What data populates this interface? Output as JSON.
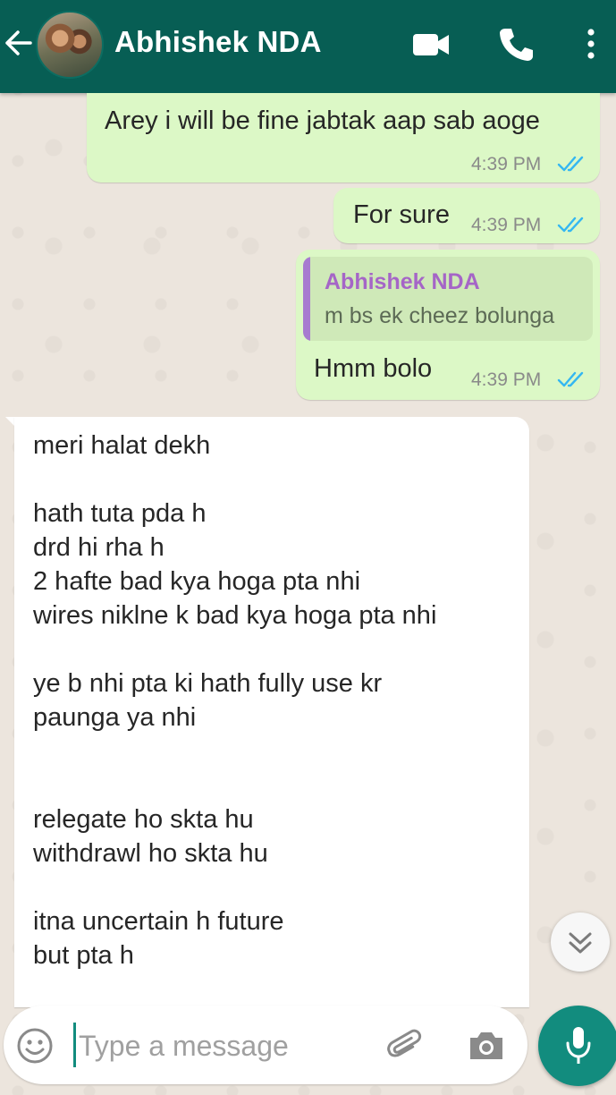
{
  "header": {
    "contact_name": "Abhishek NDA",
    "back_icon": "arrow-left-icon",
    "video_icon": "videocam-icon",
    "call_icon": "phone-icon",
    "menu_icon": "more-vert-icon",
    "bg_color": "#075e54"
  },
  "messages": {
    "m1": {
      "text": "Arey i will be fine jabtak aap sab aoge",
      "time": "4:39 PM",
      "status": "read"
    },
    "m2": {
      "text": "For sure",
      "time": "4:39 PM",
      "status": "read"
    },
    "m3": {
      "quote_author": "Abhishek NDA",
      "quote_text": "m bs ek cheez bolunga",
      "text": "Hmm bolo",
      "time": "4:39 PM",
      "status": "read"
    },
    "m4": {
      "lines": [
        "meri halat dekh",
        "hath tuta pda h",
        "drd hi rha h",
        "2 hafte bad kya hoga pta nhi",
        "wires niklne k bad kya hoga pta nhi",
        "ye b nhi pta ki hath fully use kr",
        "paunga ya nhi",
        "relegate ho skta hu",
        "withdrawl ho skta hu",
        "itna uncertain h future",
        "but pta h"
      ]
    }
  },
  "composer": {
    "placeholder": "Type a message",
    "emoji_icon": "emoji-icon",
    "attach_icon": "paperclip-icon",
    "camera_icon": "camera-icon",
    "mic_icon": "mic-icon"
  },
  "colors": {
    "outgoing_bubble": "#dcf8c6",
    "incoming_bubble": "#ffffff",
    "read_tick": "#34b7f1",
    "accent": "#128c7e"
  }
}
